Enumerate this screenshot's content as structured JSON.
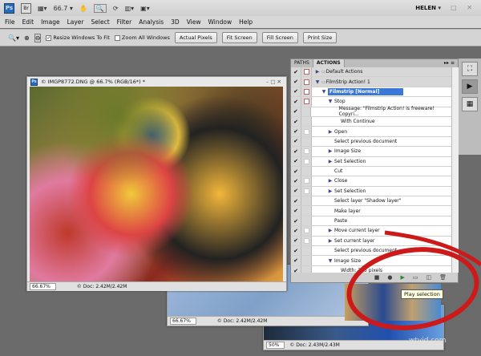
{
  "app": {
    "logo": "Ps",
    "bridge": "Br",
    "zoom": "66.7 ▾",
    "user": "HELEN ▾",
    "window_controls": "– □ ✕"
  },
  "menu": [
    "File",
    "Edit",
    "Image",
    "Layer",
    "Select",
    "Filter",
    "Analysis",
    "3D",
    "View",
    "Window",
    "Help"
  ],
  "options": {
    "resize_label": "Resize Windows To Fit",
    "resize_checked": true,
    "zoom_all_label": "Zoom All Windows",
    "zoom_all_checked": false,
    "buttons": [
      "Actual Pixels",
      "Fit Screen",
      "Fill Screen",
      "Print Size"
    ]
  },
  "doc1": {
    "title": "© IMGP8772.DNG @ 66.7% (RGB/16*) *",
    "zoom": "66.67%",
    "doc": "© Doc: 2.42M/2.42M"
  },
  "doc2": {
    "zoom": "66.67%",
    "doc": "© Doc: 2.42M/2.42M"
  },
  "doc3": {
    "zoom": "50%",
    "doc": "© Doc: 2.43M/2.43M"
  },
  "actions_panel": {
    "tabs": [
      "PATHS",
      "ACTIONS"
    ],
    "rows": [
      {
        "label": "Default Actions",
        "level": 0,
        "expander": "right",
        "folder": true
      },
      {
        "label": "FilmStrip Action! 1",
        "level": 0,
        "expander": "down",
        "folder": true
      },
      {
        "label": "Filmstrip [Normal]",
        "level": 1,
        "expander": "down",
        "selected": true
      },
      {
        "label": "Stop",
        "level": 2,
        "expander": "down"
      },
      {
        "label": "Message:  \"Filmstrip Action! is freeware!  Copyri...",
        "level": 3
      },
      {
        "label": "With Continue",
        "level": 3
      },
      {
        "label": "Open",
        "level": 2,
        "expander": "right"
      },
      {
        "label": "Select previous document",
        "level": 2
      },
      {
        "label": "Image Size",
        "level": 2,
        "expander": "right"
      },
      {
        "label": "Set Selection",
        "level": 2,
        "expander": "right"
      },
      {
        "label": "Cut",
        "level": 2
      },
      {
        "label": "Close",
        "level": 2,
        "expander": "right"
      },
      {
        "label": "Set Selection",
        "level": 2,
        "expander": "right"
      },
      {
        "label": "Select layer \"Shadow layer\"",
        "level": 2
      },
      {
        "label": "Make layer",
        "level": 2
      },
      {
        "label": "Paste",
        "level": 2
      },
      {
        "label": "Move current layer",
        "level": 2,
        "expander": "right"
      },
      {
        "label": "Set current layer",
        "level": 2,
        "expander": "right"
      },
      {
        "label": "Select previous document",
        "level": 2
      },
      {
        "label": "Image Size",
        "level": 2,
        "expander": "down"
      },
      {
        "label": "Width: 735 pixels",
        "level": 3
      }
    ],
    "footer_icons": [
      "stop-icon",
      "record-icon",
      "play-icon",
      "new-set-icon",
      "new-action-icon",
      "delete-icon"
    ],
    "tooltip": "Play selection"
  },
  "annotation_color": "#cc1a1a",
  "watermark": "wtvid.com"
}
